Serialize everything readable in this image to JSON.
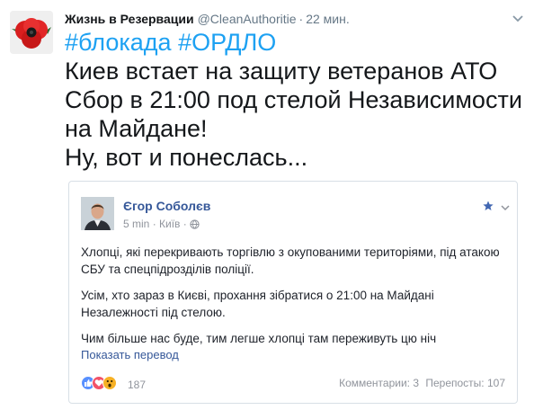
{
  "tweet": {
    "author_name": "Жизнь в Резервации",
    "handle": "@CleanAuthoritie",
    "separator": "·",
    "time": "22 мин.",
    "hashtags": [
      "#блокада",
      "#ОРДЛО"
    ],
    "text_lines": [
      "Киев встает на защиту ветеранов АТО",
      "Сбор в 21:00 под стелой Независимости",
      "на Майдане!",
      "Ну, вот и понеслась..."
    ],
    "icons": {
      "avatar": "red-poppy-avatar",
      "menu": "chevron-down-icon"
    }
  },
  "embed": {
    "author_name": "Єгор Соболєв",
    "time": "5 min",
    "location_sep": "·",
    "location": "Київ",
    "meta_sep": "·",
    "paragraphs": [
      "Хлопці, які перекривають торгівлю з окупованими територіями, під атакою СБУ та спецпідрозділів поліції.",
      "Усім, хто зараз в Києві, прохання зібратися о 21:00 на Майдані Незалежності під стелою.",
      "Чим більше нас буде, тим легше хлопці там переживуть цю ніч"
    ],
    "translate_label": "Показать перевод",
    "reactions_count": "187",
    "comments": "Комментарии: 3",
    "shares": "Перепосты: 107",
    "colors": {
      "link": "#365899",
      "like": "#5890ff",
      "love": "#f25268",
      "wow": "#f7b125"
    },
    "icons": [
      "globe-icon",
      "star-icon",
      "chevron-down-icon",
      "like-icon",
      "love-icon",
      "wow-icon"
    ]
  }
}
